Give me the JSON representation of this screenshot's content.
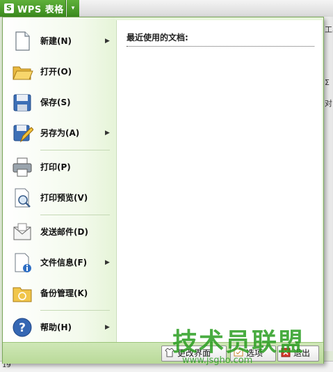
{
  "app": {
    "logo_letter": "S",
    "title": "WPS 表格",
    "dropdown_glyph": "▾",
    "brand_color": "#3b8a1e"
  },
  "background": {
    "ribbon_fragments": [
      "工具",
      "Σ",
      "对"
    ],
    "row_number": "19"
  },
  "menu": {
    "items": [
      {
        "label": "新建(N)",
        "icon": "new-document-icon",
        "submenu": true
      },
      {
        "label": "打开(O)",
        "icon": "open-folder-icon",
        "submenu": false
      },
      {
        "label": "保存(S)",
        "icon": "save-disk-icon",
        "submenu": false
      },
      {
        "label": "另存为(A)",
        "icon": "save-as-icon",
        "submenu": true
      },
      {
        "label": "打印(P)",
        "icon": "printer-icon",
        "submenu": false
      },
      {
        "label": "打印预览(V)",
        "icon": "print-preview-icon",
        "submenu": false
      },
      {
        "label": "发送邮件(D)",
        "icon": "mail-envelope-icon",
        "submenu": false
      },
      {
        "label": "文件信息(F)",
        "icon": "file-info-icon",
        "submenu": true
      },
      {
        "label": "备份管理(K)",
        "icon": "backup-folder-icon",
        "submenu": false
      },
      {
        "label": "帮助(H)",
        "icon": "help-icon",
        "submenu": true
      }
    ],
    "submenu_arrow": "▶",
    "recent_documents_title": "最近使用的文档:"
  },
  "bottom_bar": {
    "buttons": [
      "更改界面",
      "选项",
      "退出"
    ]
  },
  "watermark": {
    "text": "技术员联盟",
    "url": "www.jsgho.com"
  }
}
